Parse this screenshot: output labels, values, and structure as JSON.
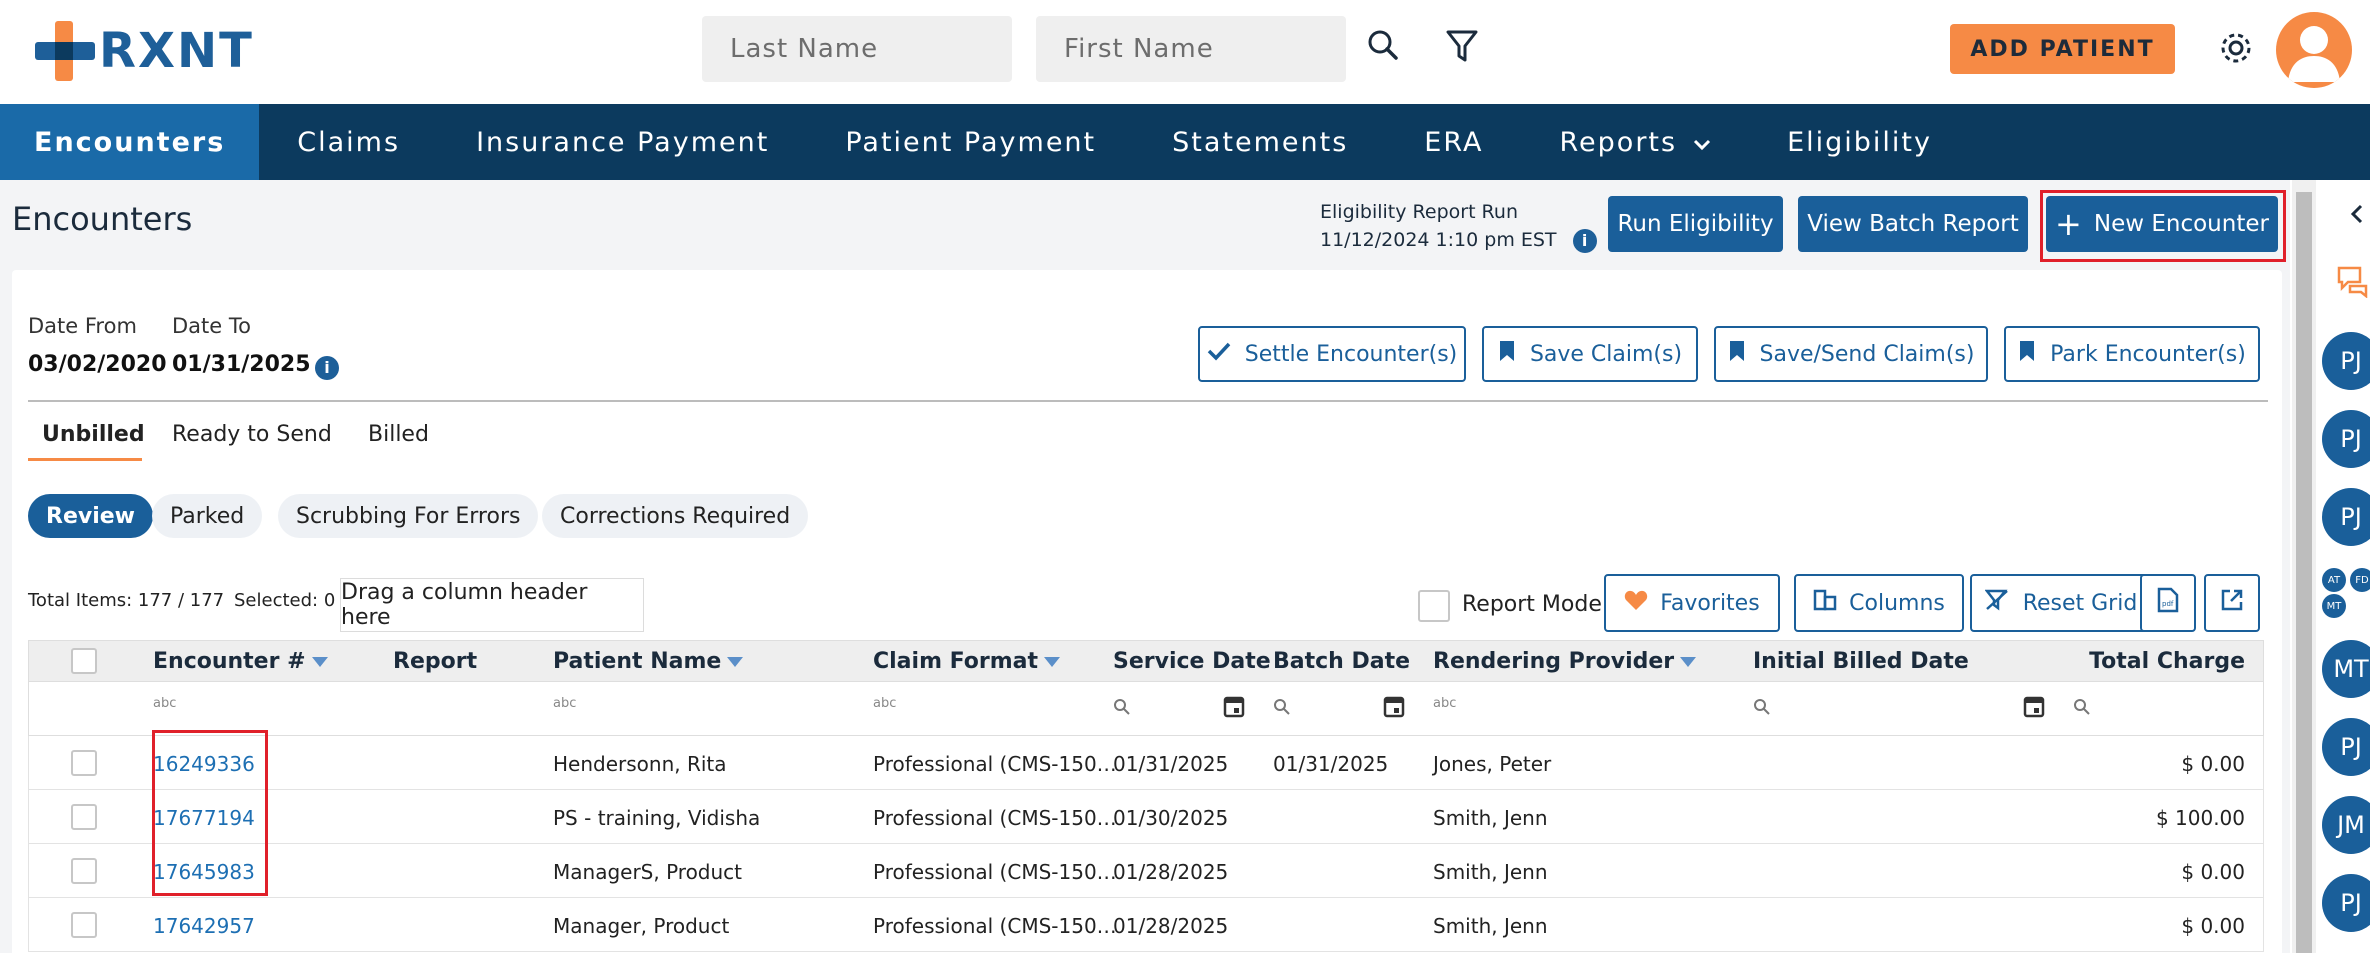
{
  "header": {
    "logo_text": "RXNT",
    "last_name_placeholder": "Last Name",
    "first_name_placeholder": "First Name",
    "add_patient_label": "ADD PATIENT",
    "colors": {
      "brand_blue": "#1e5f99",
      "accent_orange": "#f68a45"
    }
  },
  "nav": {
    "items": [
      "Encounters",
      "Claims",
      "Insurance Payment",
      "Patient Payment",
      "Statements",
      "ERA",
      "Reports",
      "Eligibility"
    ],
    "active": "Encounters"
  },
  "page": {
    "title": "Encounters",
    "eligibility_line1": "Eligibility Report Run",
    "eligibility_line2": "11/12/2024 1:10 pm EST",
    "run_eligibility": "Run Eligibility",
    "view_batch_report": "View Batch Report",
    "new_encounter": "New Encounter"
  },
  "filters": {
    "date_from_label": "Date From",
    "date_from_value": "03/02/2020",
    "date_to_label": "Date To",
    "date_to_value": "01/31/2025"
  },
  "actions": {
    "settle": "Settle Encounter(s)",
    "save": "Save Claim(s)",
    "save_send": "Save/Send Claim(s)",
    "park": "Park Encounter(s)"
  },
  "tabs": [
    "Unbilled",
    "Ready to Send",
    "Billed"
  ],
  "pills": [
    "Review",
    "Parked",
    "Scrubbing For Errors",
    "Corrections Required"
  ],
  "grid_tools": {
    "total_items": "Total Items: 177 / 177",
    "selected": "Selected: 0",
    "drag_hint": "Drag a column header here",
    "report_mode": "Report Mode",
    "favorites": "Favorites",
    "columns": "Columns",
    "reset_grid": "Reset Grid"
  },
  "table": {
    "headers": [
      "Encounter #",
      "Report",
      "Patient Name",
      "Claim Format",
      "Service Date",
      "Batch Date",
      "Rendering Provider",
      "Initial Billed Date",
      "Total Charge"
    ],
    "filter_hint": "abc",
    "rows": [
      {
        "encounter": "16249336",
        "report": "",
        "patient": "Hendersonn, Rita",
        "format": "Professional (CMS-150…",
        "service": "01/31/2025",
        "batch": "01/31/2025",
        "provider": "Jones, Peter",
        "billed": "",
        "charge": "$ 0.00"
      },
      {
        "encounter": "17677194",
        "report": "",
        "patient": "PS - training, Vidisha",
        "format": "Professional (CMS-150…",
        "service": "01/30/2025",
        "batch": "",
        "provider": "Smith, Jenn",
        "billed": "",
        "charge": "$ 100.00"
      },
      {
        "encounter": "17645983",
        "report": "",
        "patient": "ManagerS, Product",
        "format": "Professional (CMS-150…",
        "service": "01/28/2025",
        "batch": "",
        "provider": "Smith, Jenn",
        "billed": "",
        "charge": "$ 0.00"
      },
      {
        "encounter": "17642957",
        "report": "",
        "patient": "Manager, Product",
        "format": "Professional (CMS-150…",
        "service": "01/28/2025",
        "batch": "",
        "provider": "Smith, Jenn",
        "billed": "",
        "charge": "$ 0.00"
      }
    ]
  },
  "rail": {
    "avatars": [
      "PJ",
      "PJ",
      "PJ",
      "MT",
      "PJ",
      "JM",
      "PJ"
    ],
    "mini": [
      "AT",
      "FD",
      "MT"
    ]
  }
}
